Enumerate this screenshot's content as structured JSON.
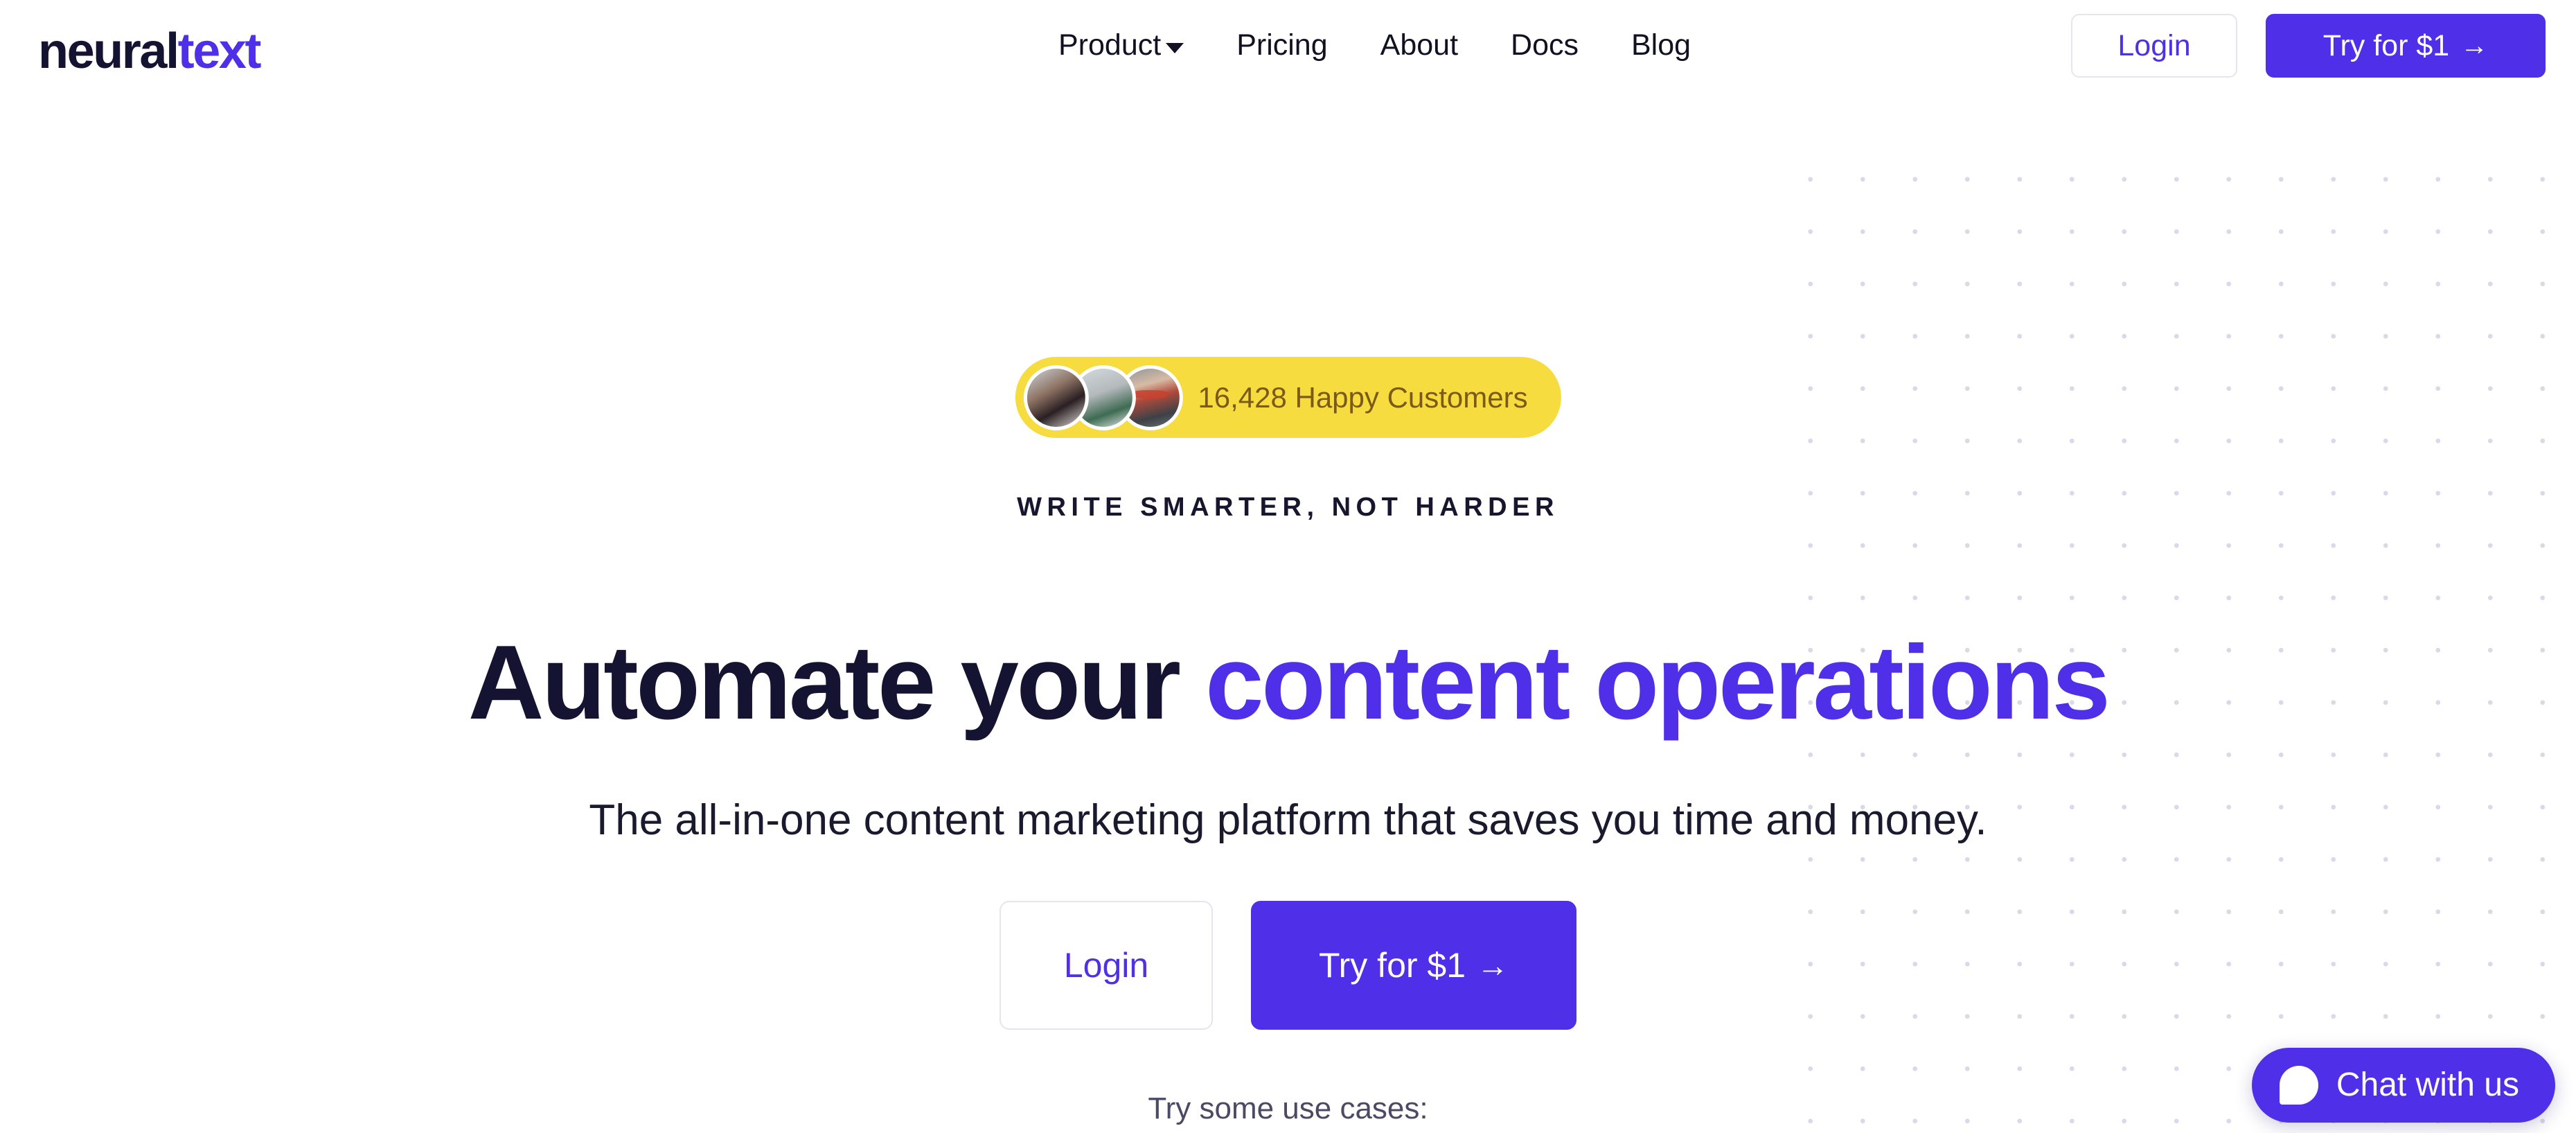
{
  "brand": {
    "logo_part1": "neural",
    "logo_part2": "text",
    "accent_color": "#4f2fe8",
    "dark_color": "#141331",
    "badge_yellow": "#f6dc3f"
  },
  "header": {
    "nav": [
      {
        "label": "Product",
        "has_dropdown": true,
        "icon": "chevron-down-icon"
      },
      {
        "label": "Pricing",
        "has_dropdown": false
      },
      {
        "label": "About",
        "has_dropdown": false
      },
      {
        "label": "Docs",
        "has_dropdown": false
      },
      {
        "label": "Blog",
        "has_dropdown": false
      }
    ],
    "login_label": "Login",
    "trial_label": "Try for $1",
    "trial_arrow": "→"
  },
  "hero": {
    "badge": {
      "count_text": "16,428 Happy Customers",
      "avatars": [
        "avatar-customer-1",
        "avatar-customer-2",
        "avatar-customer-3"
      ]
    },
    "eyebrow": "WRITE SMARTER, NOT HARDER",
    "headline_lead": "Automate your ",
    "headline_accent": "content operations",
    "subheadline": "The all-in-one content marketing platform that saves you time and money.",
    "cta_login": "Login",
    "cta_trial": "Try for $1",
    "cta_trial_arrow": "→",
    "use_cases_label": "Try some use cases:"
  },
  "chat": {
    "label": "Chat with us",
    "icon": "chat-bubble-icon"
  }
}
